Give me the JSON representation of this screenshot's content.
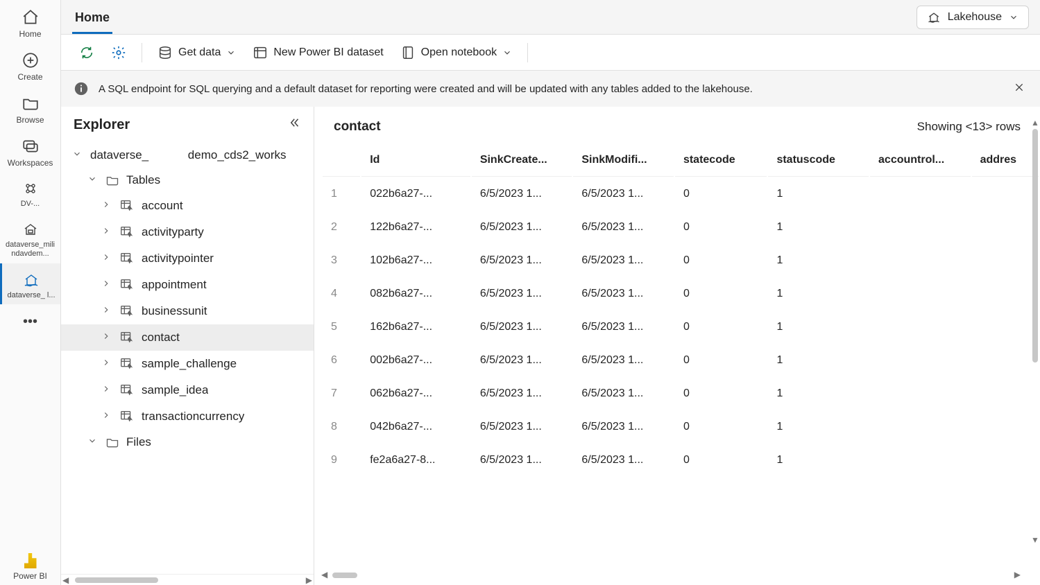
{
  "leftNav": {
    "home": "Home",
    "create": "Create",
    "browse": "Browse",
    "workspaces": "Workspaces",
    "item1": "DV-...",
    "item2": "dataverse_milindavdem...",
    "item3": "dataverse_            l...",
    "powerbi": "Power BI"
  },
  "topTab": "Home",
  "lakehouse_label": "Lakehouse",
  "toolbar": {
    "getdata": "Get data",
    "newdataset": "New Power BI dataset",
    "opennotebook": "Open notebook"
  },
  "infobar": "A SQL endpoint for SQL querying and a default dataset for reporting were created and will be updated with any tables added to the lakehouse.",
  "explorer": {
    "title": "Explorer",
    "root": "dataverse_            demo_cds2_works",
    "tables_label": "Tables",
    "files_label": "Files",
    "tables": [
      "account",
      "activityparty",
      "activitypointer",
      "appointment",
      "businessunit",
      "contact",
      "sample_challenge",
      "sample_idea",
      "transactioncurrency"
    ],
    "selected": "contact"
  },
  "dataPanel": {
    "tableName": "contact",
    "rowsText": "Showing <13> rows",
    "columns": [
      "Id",
      "SinkCreate...",
      "SinkModifi...",
      "statecode",
      "statuscode",
      "accountrol...",
      "addres"
    ],
    "rows": [
      {
        "n": "1",
        "Id": "022b6a27-...",
        "SinkCreate": "6/5/2023 1...",
        "SinkModifi": "6/5/2023 1...",
        "statecode": "0",
        "statuscode": "1"
      },
      {
        "n": "2",
        "Id": "122b6a27-...",
        "SinkCreate": "6/5/2023 1...",
        "SinkModifi": "6/5/2023 1...",
        "statecode": "0",
        "statuscode": "1"
      },
      {
        "n": "3",
        "Id": "102b6a27-...",
        "SinkCreate": "6/5/2023 1...",
        "SinkModifi": "6/5/2023 1...",
        "statecode": "0",
        "statuscode": "1"
      },
      {
        "n": "4",
        "Id": "082b6a27-...",
        "SinkCreate": "6/5/2023 1...",
        "SinkModifi": "6/5/2023 1...",
        "statecode": "0",
        "statuscode": "1"
      },
      {
        "n": "5",
        "Id": "162b6a27-...",
        "SinkCreate": "6/5/2023 1...",
        "SinkModifi": "6/5/2023 1...",
        "statecode": "0",
        "statuscode": "1"
      },
      {
        "n": "6",
        "Id": "002b6a27-...",
        "SinkCreate": "6/5/2023 1...",
        "SinkModifi": "6/5/2023 1...",
        "statecode": "0",
        "statuscode": "1"
      },
      {
        "n": "7",
        "Id": "062b6a27-...",
        "SinkCreate": "6/5/2023 1...",
        "SinkModifi": "6/5/2023 1...",
        "statecode": "0",
        "statuscode": "1"
      },
      {
        "n": "8",
        "Id": "042b6a27-...",
        "SinkCreate": "6/5/2023 1...",
        "SinkModifi": "6/5/2023 1...",
        "statecode": "0",
        "statuscode": "1"
      },
      {
        "n": "9",
        "Id": "fe2a6a27-8...",
        "SinkCreate": "6/5/2023 1...",
        "SinkModifi": "6/5/2023 1...",
        "statecode": "0",
        "statuscode": "1"
      }
    ]
  }
}
